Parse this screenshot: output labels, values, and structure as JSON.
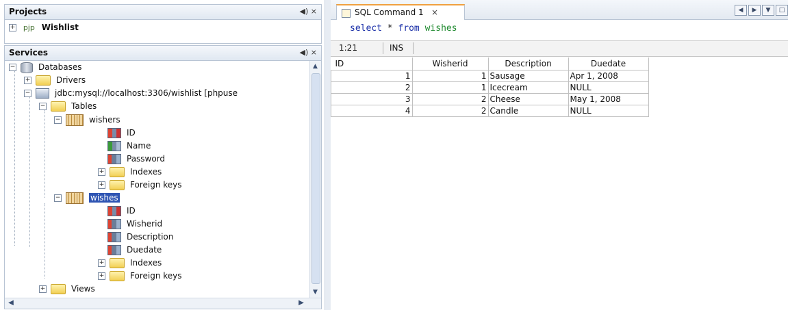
{
  "projects": {
    "title": "Projects",
    "controls": "◀) ×",
    "items": [
      {
        "label": "Wishlist",
        "prefix": "pjp"
      }
    ]
  },
  "services": {
    "title": "Services",
    "controls": "◀) ×",
    "tree": {
      "databases": "Databases",
      "drivers": "Drivers",
      "connection": "jdbc:mysql://localhost:3306/wishlist [phpuse",
      "tables": "Tables",
      "wishers": "wishers",
      "wishers_cols": [
        "ID",
        "Name",
        "Password"
      ],
      "indexes": "Indexes",
      "foreign_keys": "Foreign keys",
      "wishes": "wishes",
      "wishes_cols": [
        "ID",
        "Wisherid",
        "Description",
        "Duedate"
      ],
      "views": "Views"
    }
  },
  "editor": {
    "tab_label": "SQL Command 1",
    "tab_close": "×",
    "sql": {
      "kw1": "select",
      "star": "*",
      "kw2": "from",
      "table": "wishes"
    },
    "status": {
      "position": "1:21",
      "mode": "INS"
    }
  },
  "results": {
    "columns": [
      "ID",
      "Wisherid",
      "Description",
      "Duedate"
    ],
    "rows": [
      [
        "1",
        "1",
        "Sausage",
        "Apr 1, 2008"
      ],
      [
        "2",
        "1",
        "Icecream",
        "NULL"
      ],
      [
        "3",
        "2",
        "Cheese",
        "May 1, 2008"
      ],
      [
        "4",
        "2",
        "Candle",
        "NULL"
      ]
    ]
  },
  "colors": {
    "selection": "#2f55b3",
    "keyword": "#1a2fa8",
    "table_name": "#1f8a2f",
    "tab_accent": "#f0a040"
  }
}
